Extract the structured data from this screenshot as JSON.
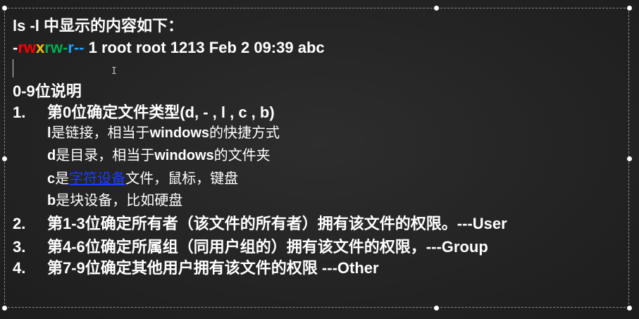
{
  "slide": {
    "title": "ls  -l 中显示的内容如下：",
    "perm_line": {
      "dash": "-",
      "r1": "r",
      "w1": "w",
      "x1": "x",
      "r2": "r",
      "w2": "w",
      "dash2": "-",
      "r3": "r",
      "dash3": "--",
      "rest": " 1 root root 1213 Feb 2 09:39 abc"
    },
    "section_title": "0-9位说明",
    "items": [
      {
        "num": "1.",
        "text": "第0位确定文件类型(d, - , l , c , b)"
      },
      {
        "num": "2.",
        "text": "第1-3位确定所有者（该文件的所有者）拥有该文件的权限。---User"
      },
      {
        "num": "3.",
        "text": "第4-6位确定所属组（同用户组的）拥有该文件的权限，---Group"
      },
      {
        "num": "4.",
        "text": "第7-9位确定其他用户拥有该文件的权限 ---Other"
      }
    ],
    "subs": {
      "l": {
        "letter": "l",
        "text": "是链接，相当于",
        "win": "windows",
        "tail": "的快捷方式"
      },
      "d": {
        "letter": "d",
        "text": "是目录，相当于",
        "win": "windows",
        "tail": "的文件夹"
      },
      "c": {
        "letter": "c",
        "text": "是",
        "link": "字符设备",
        "tail": "文件，鼠标，键盘"
      },
      "b": {
        "letter": "b",
        "text": "是块设备，比如硬盘"
      }
    }
  },
  "colors": {
    "background": "#242424",
    "yellow": "#ffc000",
    "red": "#ff0000",
    "green": "#00b050",
    "blue": "#1aa3ff",
    "link": "#1a3cff"
  }
}
